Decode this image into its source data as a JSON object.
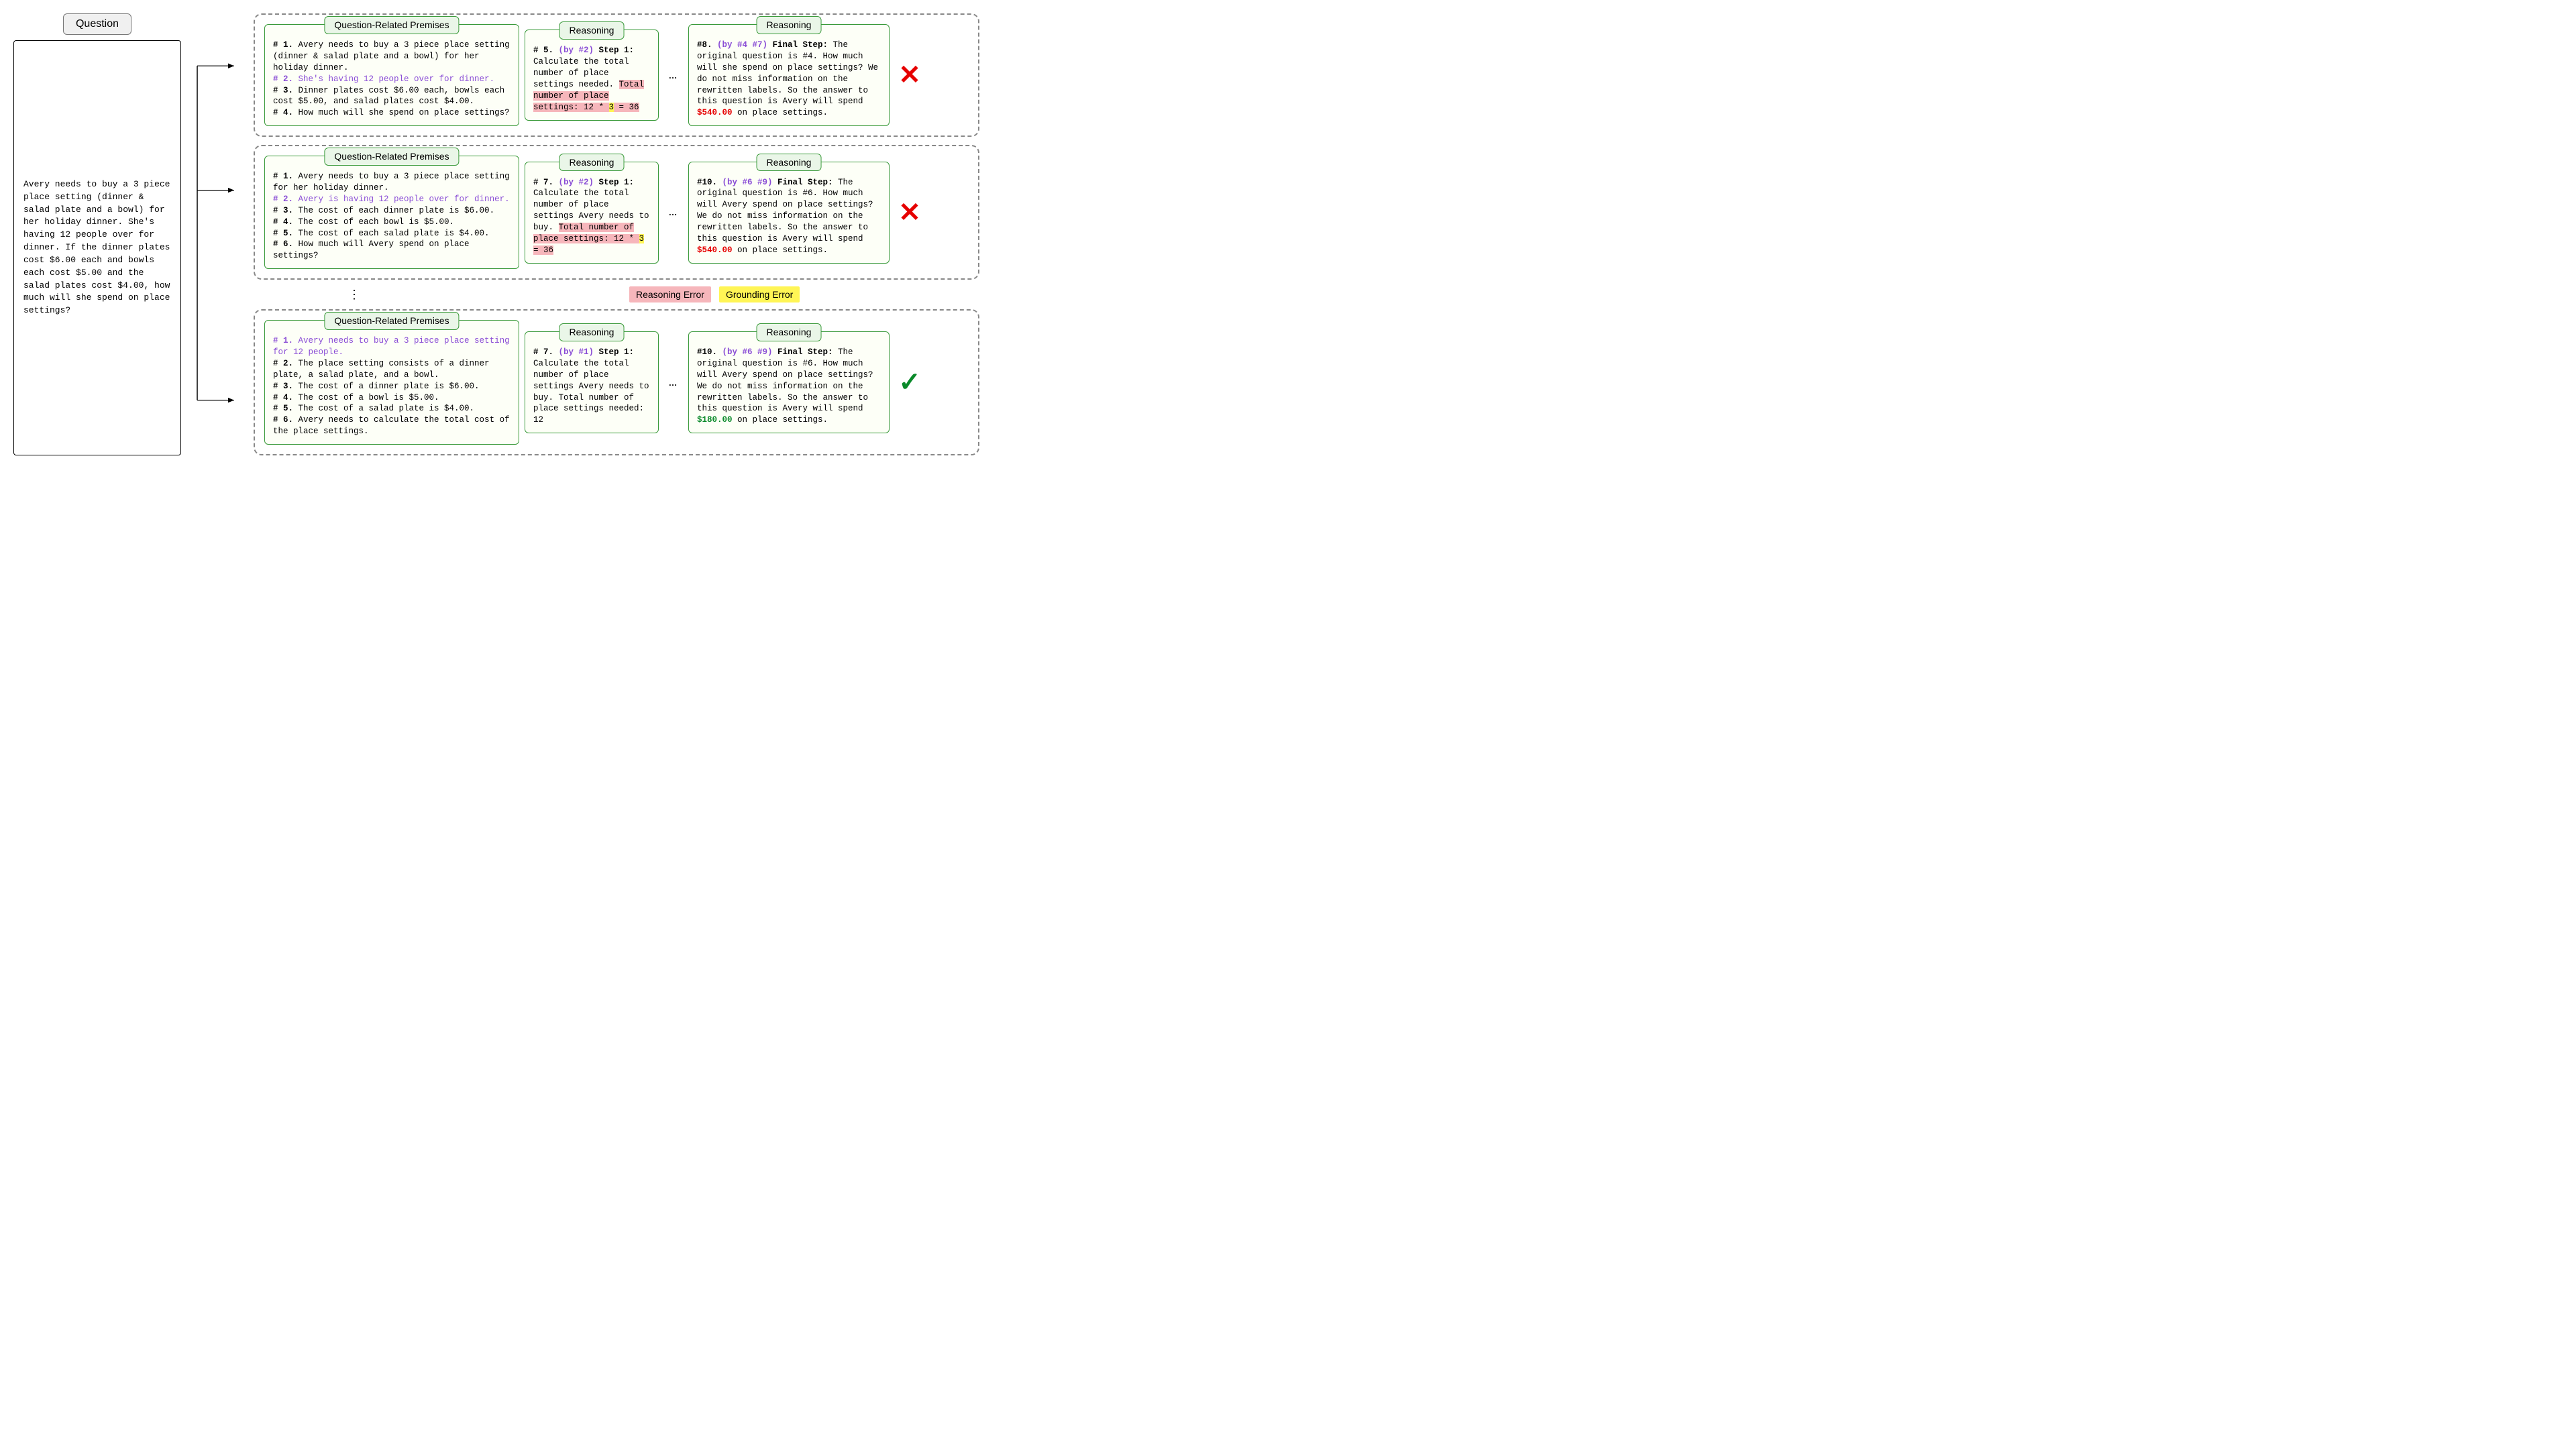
{
  "question": {
    "label": "Question",
    "body": "Avery needs to buy a 3 piece place setting (dinner & salad plate and a bowl) for her holiday dinner.  She's having 12 people over for dinner.  If the dinner plates cost $6.00 each and bowls each cost $5.00 and the salad plates cost $4.00, how much will she spend on place settings?"
  },
  "labels": {
    "premises": "Question-Related Premises",
    "reasoning": "Reasoning",
    "ellipsis": "…"
  },
  "legend": {
    "reasoning_error": "Reasoning Error",
    "grounding_error": "Grounding Error"
  },
  "paths": [
    {
      "premises": {
        "p1_num": "# 1.",
        "p1": " Avery needs to buy a 3 piece place setting (dinner & salad plate and a bowl) for her holiday dinner.",
        "p2_num": "# 2.",
        "p2": " She's having 12 people over for dinner.",
        "p3_num": "# 3.",
        "p3": " Dinner plates cost $6.00 each, bowls each cost $5.00, and salad plates cost $4.00.",
        "p4_num": "# 4.",
        "p4": " How much will she spend on place settings?"
      },
      "r1": {
        "step_num": "# 5.",
        "by": " (by #2)",
        "step_label": " Step 1:",
        "lead": "Calculate the total number of place settings needed.",
        "hl_pre": "Total number of place settings: 12 * ",
        "hl_ground": "3",
        "hl_post": " = 36"
      },
      "r2": {
        "step_num": "#8.",
        "by": " (by #4 #7)",
        "step_label": " Final Step:",
        "body_a": " The original question is #4. How much will she spend on place settings? We do not miss information on the rewritten labels. So the answer to this question is Avery will spend ",
        "answer": "$540.00",
        "body_b": " on place settings."
      },
      "correct": false
    },
    {
      "premises": {
        "p1_num": "# 1.",
        "p1": " Avery needs to buy a 3 piece place setting for her holiday dinner.",
        "p2_num": "# 2.",
        "p2": " Avery is having 12 people over for dinner.",
        "p3_num": "# 3.",
        "p3": " The cost of each dinner plate is $6.00.",
        "p4_num": "# 4.",
        "p4": " The cost of each bowl is $5.00.",
        "p5_num": "# 5.",
        "p5": " The cost of each salad plate is $4.00.",
        "p6_num": "# 6.",
        "p6": " How much will Avery spend on place settings?"
      },
      "r1": {
        "step_num": "# 7.",
        "by": " (by #2)",
        "step_label": " Step 1:",
        "lead": "Calculate the total number of place settings Avery needs to buy. ",
        "hl_pre": "Total number of place settings: 12 * ",
        "hl_ground": "3",
        "hl_post": " = 36"
      },
      "r2": {
        "step_num": "#10.",
        "by": " (by #6 #9)",
        "step_label": " Final Step:",
        "body_a": " The original question is #6. How much will Avery spend on place settings? We do not miss information on the rewritten labels. So the answer to this question is Avery will spend ",
        "answer": "$540.00",
        "body_b": " on place settings."
      },
      "correct": false
    },
    {
      "premises": {
        "p1_num": "# 1.",
        "p1": " Avery needs to buy a 3 piece place setting for 12 people.",
        "p2_num": "# 2.",
        "p2": " The place setting consists of a dinner plate, a salad plate, and a bowl.",
        "p3_num": "# 3.",
        "p3": " The cost of a dinner plate is $6.00.",
        "p4_num": "# 4.",
        "p4": " The cost of a bowl is $5.00.",
        "p5_num": "# 5.",
        "p5": " The cost of a salad plate is $4.00.",
        "p6_num": "# 6.",
        "p6": " Avery needs to calculate the total cost of the place settings."
      },
      "r1": {
        "step_num": "# 7.",
        "by": " (by #1)",
        "step_label": " Step 1:",
        "body": "Calculate the total number of place settings Avery needs to buy. Total number of place settings needed: 12"
      },
      "r2": {
        "step_num": "#10.",
        "by": " (by #6 #9)",
        "step_label": " Final Step:",
        "body_a": " The original question is #6. How much will Avery spend on place settings? We do not miss information on the rewritten labels. So the answer to this question is Avery will spend ",
        "answer": "$180.00",
        "body_b": " on place settings."
      },
      "correct": true
    }
  ]
}
